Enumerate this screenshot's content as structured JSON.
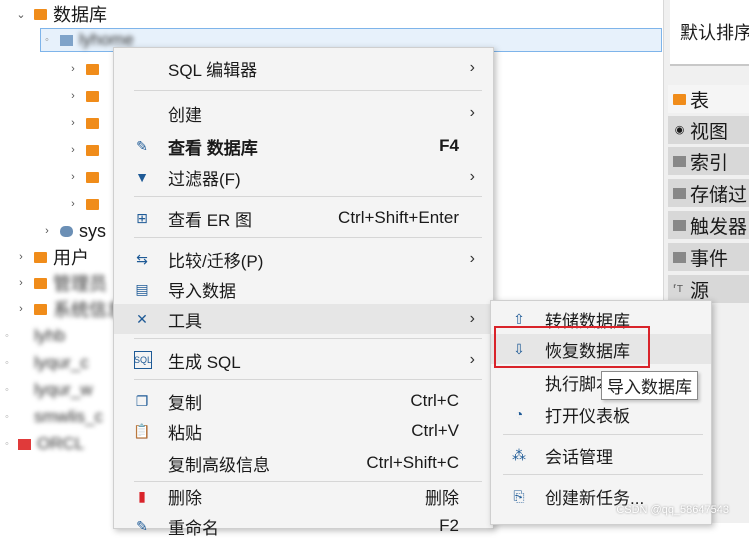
{
  "tree": {
    "root_label": "数据库",
    "sys_label": "sys",
    "users_label": "用户",
    "admin_label": "管理员",
    "sysinfo_label": "系统信息",
    "blurred_db_label": "lyhome",
    "blurred_rows": [
      "lyhb",
      "lyqur_c",
      "lyqur_w",
      "smwlis_c",
      "ORCL"
    ]
  },
  "right_panel": {
    "top_text": "默认排序",
    "tabs": [
      {
        "label": "表",
        "icon": "table-icon"
      },
      {
        "label": "视图",
        "icon": "view-icon"
      },
      {
        "label": "索引",
        "icon": "index-icon"
      },
      {
        "label": "存储过",
        "icon": "procedure-icon"
      },
      {
        "label": "触发器",
        "icon": "trigger-icon"
      },
      {
        "label": "事件",
        "icon": "event-icon"
      },
      {
        "label": "源",
        "icon": "source-icon"
      }
    ]
  },
  "context_menu": {
    "sql_editor": "SQL 编辑器",
    "create": "创建",
    "view_db": "查看 数据库",
    "view_db_shortcut": "F4",
    "filter": "过滤器(F)",
    "view_er": "查看 ER 图",
    "view_er_shortcut": "Ctrl+Shift+Enter",
    "compare": "比较/迁移(P)",
    "import": "导入数据",
    "tools": "工具",
    "gen_sql": "生成 SQL",
    "copy": "复制",
    "copy_shortcut": "Ctrl+C",
    "paste": "粘贴",
    "paste_shortcut": "Ctrl+V",
    "copy_adv": "复制高级信息",
    "copy_adv_shortcut": "Ctrl+Shift+C",
    "delete": "删除",
    "delete_shortcut": "删除",
    "rename": "重命名",
    "rename_shortcut": "F2"
  },
  "submenu": {
    "dump": "转储数据库",
    "restore": "恢复数据库",
    "exec_script": "执行脚本",
    "dashboard": "打开仪表板",
    "session": "会话管理",
    "new_task": "创建新任务..."
  },
  "tooltip": "导入数据库",
  "watermark": "CSDN @qq_58647543",
  "colors": {
    "accent": "#1e5a96",
    "folder": "#f08c1a",
    "highlight_box": "#d9232a",
    "selection": "#e7f1fb"
  }
}
